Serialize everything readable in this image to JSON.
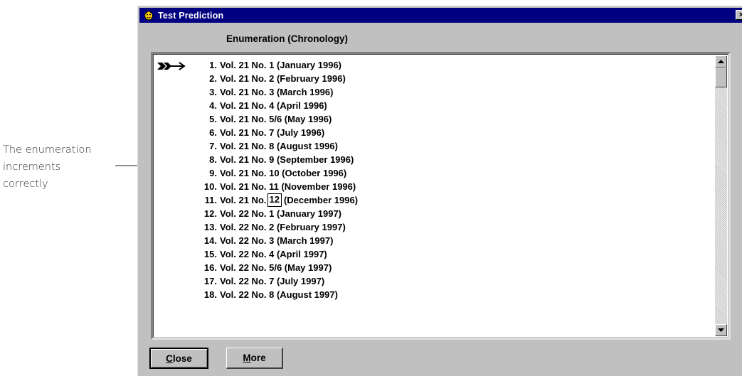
{
  "window": {
    "title": "Test Prediction",
    "close_glyph": "×"
  },
  "header": "Enumeration (Chronology)",
  "annotation": {
    "lines": [
      "The enumeration",
      "increments",
      "correctly"
    ]
  },
  "list": {
    "items": [
      {
        "num": "1.",
        "text": "Vol. 21 No. 1 (January 1996)"
      },
      {
        "num": "2.",
        "text": "Vol. 21 No. 2 (February 1996)"
      },
      {
        "num": "3.",
        "text": "Vol. 21 No. 3 (March 1996)"
      },
      {
        "num": "4.",
        "text": "Vol. 21 No. 4 (April 1996)"
      },
      {
        "num": "5.",
        "text": "Vol. 21 No. 5/6 (May 1996)"
      },
      {
        "num": "6.",
        "text": "Vol. 21 No. 7 (July 1996)"
      },
      {
        "num": "7.",
        "text": "Vol. 21 No. 8 (August 1996)"
      },
      {
        "num": "8.",
        "text": "Vol. 21 No. 9 (September 1996)"
      },
      {
        "num": "9.",
        "text": "Vol. 21 No. 10 (October 1996)"
      },
      {
        "num": "10.",
        "text": "Vol. 21 No. 11 (November 1996)"
      },
      {
        "num": "11.",
        "text_before": "Vol. 21 No.",
        "boxed": "12",
        "text_after": "(December 1996)"
      },
      {
        "num": "12.",
        "text": "Vol. 22 No. 1 (January 1997)"
      },
      {
        "num": "13.",
        "text": "Vol. 22 No. 2 (February 1997)"
      },
      {
        "num": "14.",
        "text": "Vol. 22 No. 3 (March 1997)"
      },
      {
        "num": "15.",
        "text": "Vol. 22 No. 4 (April 1997)"
      },
      {
        "num": "16.",
        "text": "Vol. 22 No. 5/6 (May 1997)"
      },
      {
        "num": "17.",
        "text": "Vol. 22 No. 7 (July 1997)"
      },
      {
        "num": "18.",
        "text": "Vol. 22 No. 8 (August 1997)"
      }
    ]
  },
  "buttons": {
    "close": {
      "hotkey": "C",
      "rest": "lose"
    },
    "more": {
      "hotkey": "M",
      "rest": "ore"
    }
  },
  "icons": {
    "app": "app-icon",
    "current_row": "arrow-pointer-icon",
    "scroll_up": "scroll-up-arrow-icon",
    "scroll_down": "scroll-down-arrow-icon"
  }
}
